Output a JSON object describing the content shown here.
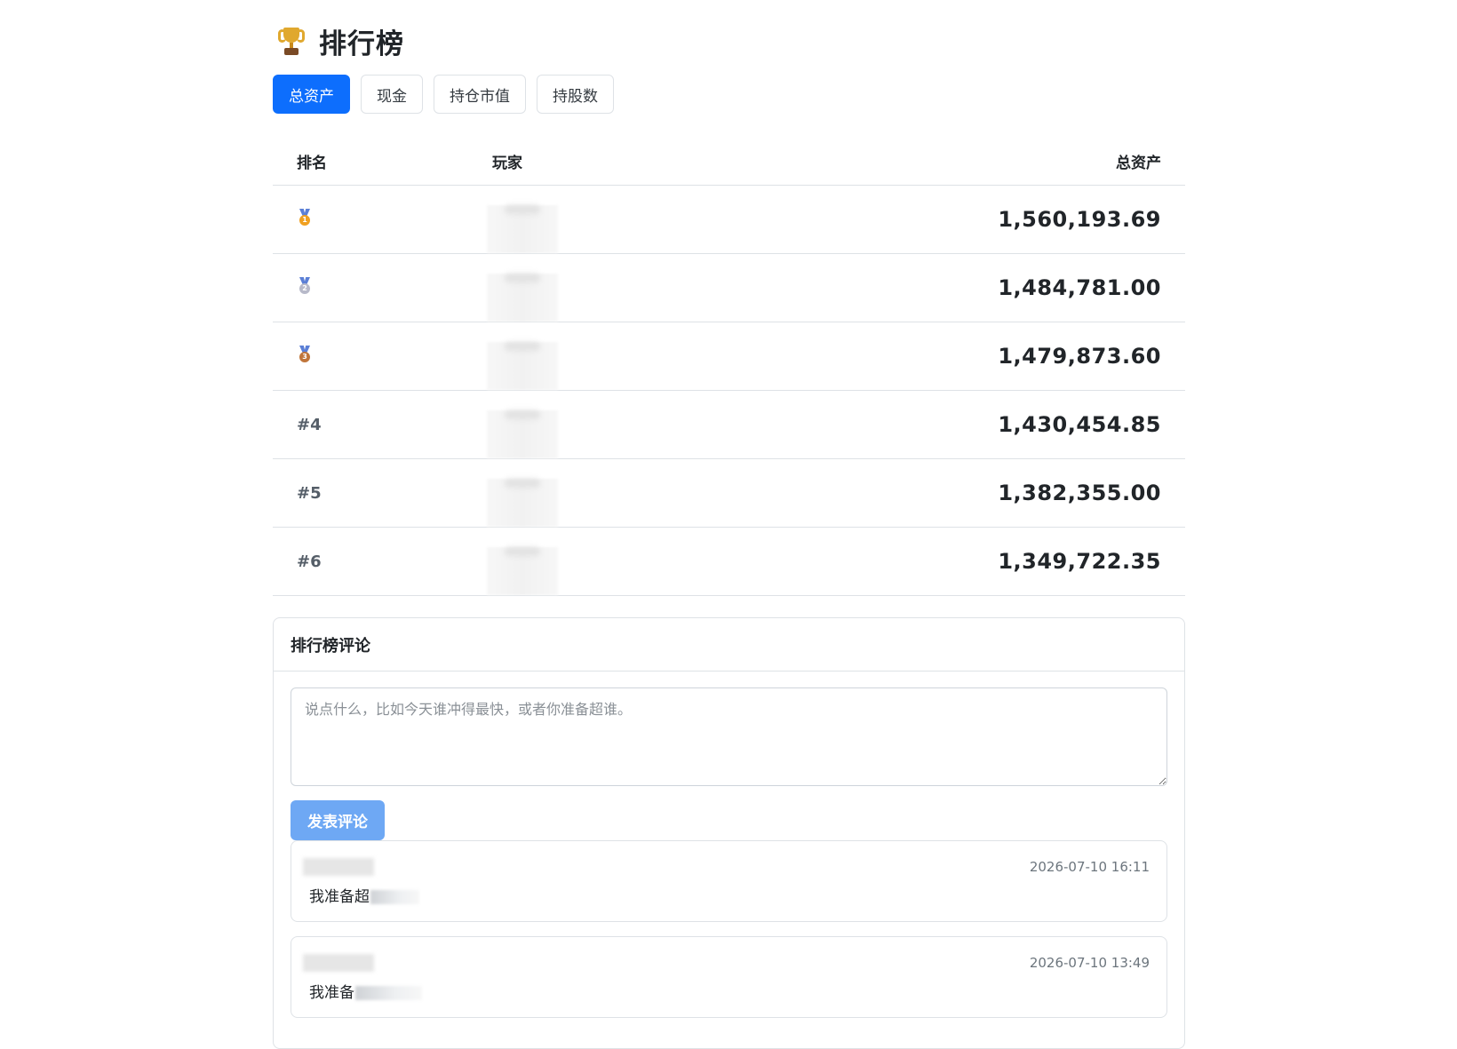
{
  "page": {
    "icon": "trophy-icon",
    "title": "排行榜"
  },
  "tabs": [
    {
      "label": "总资产",
      "active": true
    },
    {
      "label": "现金",
      "active": false
    },
    {
      "label": "持仓市值",
      "active": false
    },
    {
      "label": "持股数",
      "active": false
    }
  ],
  "table": {
    "headers": {
      "rank": "排名",
      "player": "玩家",
      "value": "总资产"
    },
    "rows": [
      {
        "rank": "1",
        "medal": "gold-medal-icon",
        "player": "",
        "value": "1,560,193.69"
      },
      {
        "rank": "2",
        "medal": "silver-medal-icon",
        "player": "",
        "value": "1,484,781.00"
      },
      {
        "rank": "3",
        "medal": "bronze-medal-icon",
        "player": "",
        "value": "1,479,873.60"
      },
      {
        "rank": "#4",
        "medal": "",
        "player": "",
        "value": "1,430,454.85"
      },
      {
        "rank": "#5",
        "medal": "",
        "player": "",
        "value": "1,382,355.00"
      },
      {
        "rank": "#6",
        "medal": "",
        "player": "",
        "value": "1,349,722.35"
      }
    ]
  },
  "comments_section": {
    "title": "排行榜评论",
    "placeholder": "说点什么，比如今天谁冲得最快，或者你准备超谁。",
    "submit_label": "发表评论",
    "comments": [
      {
        "author": "",
        "time": "2026-07-10 16:11",
        "text": "我准备超"
      },
      {
        "author": "",
        "time": "2026-07-10 13:49",
        "text": "我准备"
      }
    ]
  }
}
